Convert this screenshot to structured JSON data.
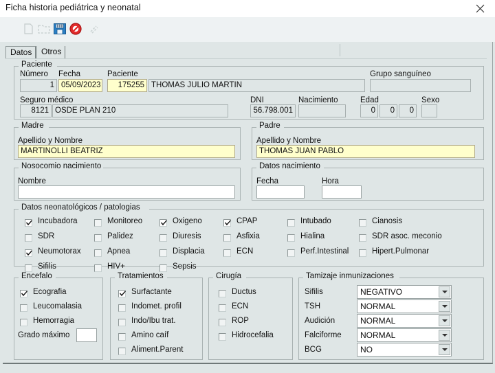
{
  "window": {
    "title": "Ficha historia pediátrica y neonatal",
    "close_label": "✕"
  },
  "toolbar": {
    "icons": [
      {
        "name": "new-record-icon",
        "label": ""
      },
      {
        "name": "open-folder-icon",
        "label": ""
      },
      {
        "name": "save-icon",
        "label": ""
      },
      {
        "name": "cancel-icon",
        "label": ""
      },
      {
        "name": "delete-icon",
        "label": ""
      }
    ]
  },
  "tabs": [
    {
      "label": "Datos",
      "selected": true
    },
    {
      "label": "Otros",
      "selected": false
    }
  ],
  "paciente": {
    "legend": "Paciente",
    "numero_label": "Número",
    "numero_value": "1",
    "fecha_label": "Fecha",
    "fecha_value": "05/09/2023",
    "paciente_label": "Paciente",
    "paciente_id": "175255",
    "paciente_nombre": "THOMAS JULIO MARTIN",
    "grupo_label": "Grupo sanguíneo",
    "grupo_value": "",
    "seguro_label": "Seguro médico",
    "seguro_id": "8121",
    "seguro_nombre": "OSDE PLAN 210",
    "dni_label": "DNI",
    "dni_value": "56.798.001",
    "nacimiento_label": "Nacimiento",
    "nacimiento_value": "",
    "edad_label": "Edad",
    "edad_anos": "0",
    "edad_meses": "0",
    "edad_dias": "0",
    "sexo_label": "Sexo",
    "sexo_value": ""
  },
  "madre": {
    "legend": "Madre",
    "apellido_label": "Apellido y Nombre",
    "apellido_value": "MARTINOLLI BEATRIZ"
  },
  "padre": {
    "legend": "Padre",
    "apellido_label": "Apellido y Nombre",
    "apellido_value": "THOMAS JUAN PABLO"
  },
  "nosocomio": {
    "legend": "Nosocomio nacimiento",
    "nombre_label": "Nombre",
    "nombre_value": ""
  },
  "datos_nacimiento": {
    "legend": "Datos nacimiento",
    "fecha_label": "Fecha",
    "fecha_value": "",
    "hora_label": "Hora",
    "hora_value": ""
  },
  "neonatologia": {
    "legend": "Datos neonatológicos / patologias",
    "columns": [
      [
        {
          "label": "Incubadora",
          "checked": true
        },
        {
          "label": "SDR",
          "checked": false
        },
        {
          "label": "Neumotorax",
          "checked": true
        },
        {
          "label": "Sifilis",
          "checked": false
        }
      ],
      [
        {
          "label": "Monitoreo",
          "checked": false
        },
        {
          "label": "Palidez",
          "checked": false
        },
        {
          "label": "Apnea",
          "checked": false
        },
        {
          "label": "HIV+",
          "checked": false
        }
      ],
      [
        {
          "label": "Oxigeno",
          "checked": true
        },
        {
          "label": "Diuresis",
          "checked": false
        },
        {
          "label": "Displacia",
          "checked": false
        },
        {
          "label": "Sepsis",
          "checked": false
        }
      ],
      [
        {
          "label": "CPAP",
          "checked": true
        },
        {
          "label": "Asfixia",
          "checked": false
        },
        {
          "label": "ECN",
          "checked": false
        }
      ],
      [
        {
          "label": "Intubado",
          "checked": false
        },
        {
          "label": "Hialina",
          "checked": false
        },
        {
          "label": "Perf.Intestinal",
          "checked": false
        }
      ],
      [
        {
          "label": "Cianosis",
          "checked": false
        },
        {
          "label": "SDR asoc. meconio",
          "checked": false
        },
        {
          "label": "Hipert.Pulmonar",
          "checked": false
        }
      ]
    ]
  },
  "encefalo": {
    "legend": "Encefalo",
    "items": [
      {
        "label": "Ecografia",
        "checked": true
      },
      {
        "label": "Leucomalasia",
        "checked": false
      },
      {
        "label": "Hemorragia",
        "checked": false
      }
    ],
    "grado_label": "Grado máximo",
    "grado_value": ""
  },
  "tratamientos": {
    "legend": "Tratamientos",
    "items": [
      {
        "label": "Surfactante",
        "checked": true
      },
      {
        "label": "Indomet. profil",
        "checked": false
      },
      {
        "label": "Indo/Ibu trat.",
        "checked": false
      },
      {
        "label": "Amino caíf",
        "checked": false
      },
      {
        "label": "Aliment.Parent",
        "checked": false
      }
    ]
  },
  "cirugia": {
    "legend": "Cirugía",
    "items": [
      {
        "label": "Ductus",
        "checked": false
      },
      {
        "label": "ECN",
        "checked": false
      },
      {
        "label": "ROP",
        "checked": false
      },
      {
        "label": "Hidrocefalia",
        "checked": false
      }
    ]
  },
  "tamizaje": {
    "legend": "Tamizaje inmunizaciones",
    "rows": [
      {
        "label": "Sifilis",
        "value": "NEGATIVO"
      },
      {
        "label": "TSH",
        "value": "NORMAL"
      },
      {
        "label": "Audición",
        "value": "NORMAL"
      },
      {
        "label": "Falciforme",
        "value": "NORMAL"
      },
      {
        "label": "BCG",
        "value": "NO"
      }
    ]
  },
  "colors": {
    "background": "#dfe6e6",
    "titlebar": "#ffffff",
    "toolbar": "#eef2f3",
    "highlight_field": "#ffffcc",
    "border": "#a9b2b2"
  }
}
